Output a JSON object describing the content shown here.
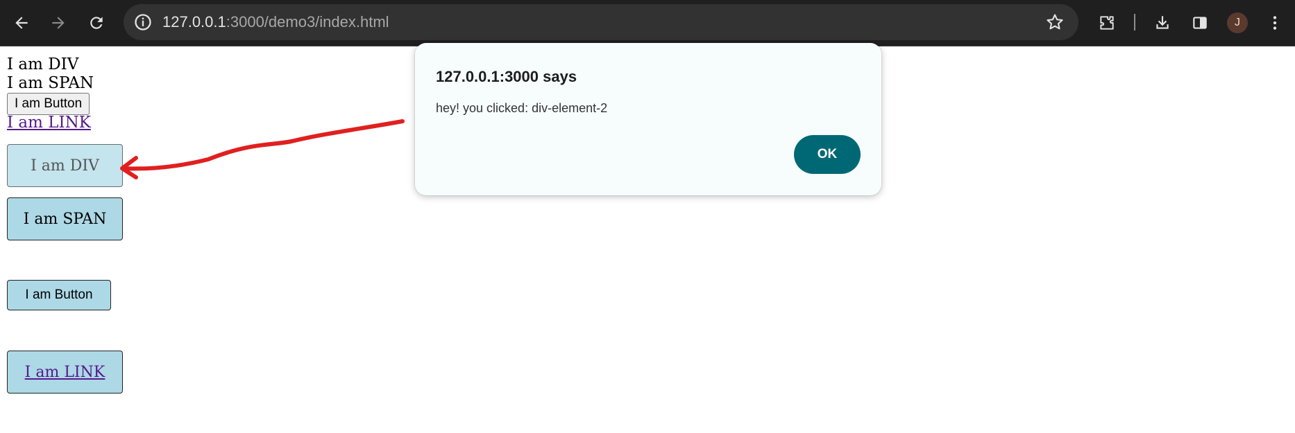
{
  "browser": {
    "url_host": "127.0.0.1",
    "url_rest": ":3000/demo3/index.html",
    "profile_initial": "J",
    "icons": [
      "back-icon",
      "forward-icon",
      "reload-icon",
      "site-info-icon",
      "bookmark-star-icon",
      "extensions-icon",
      "download-icon",
      "side-panel-icon",
      "menu-icon"
    ]
  },
  "page": {
    "div_text": "I am DIV",
    "span_text": "I am SPAN",
    "button_text": "I am Button",
    "link_text": "I am LINK",
    "styled_div_text": "I am DIV",
    "styled_span_text": "I am SPAN",
    "styled_button_text": "I am Button",
    "styled_link_text": "I am LINK"
  },
  "dialog": {
    "title": "127.0.0.1:3000 says",
    "message": "hey! you clicked: div-element-2",
    "ok_label": "OK"
  },
  "colors": {
    "toolbar_bg": "#1f1f20",
    "box_bg": "#add8e6",
    "ok_button": "#006874",
    "arrow": "#e02020",
    "link": "#551a8b"
  }
}
